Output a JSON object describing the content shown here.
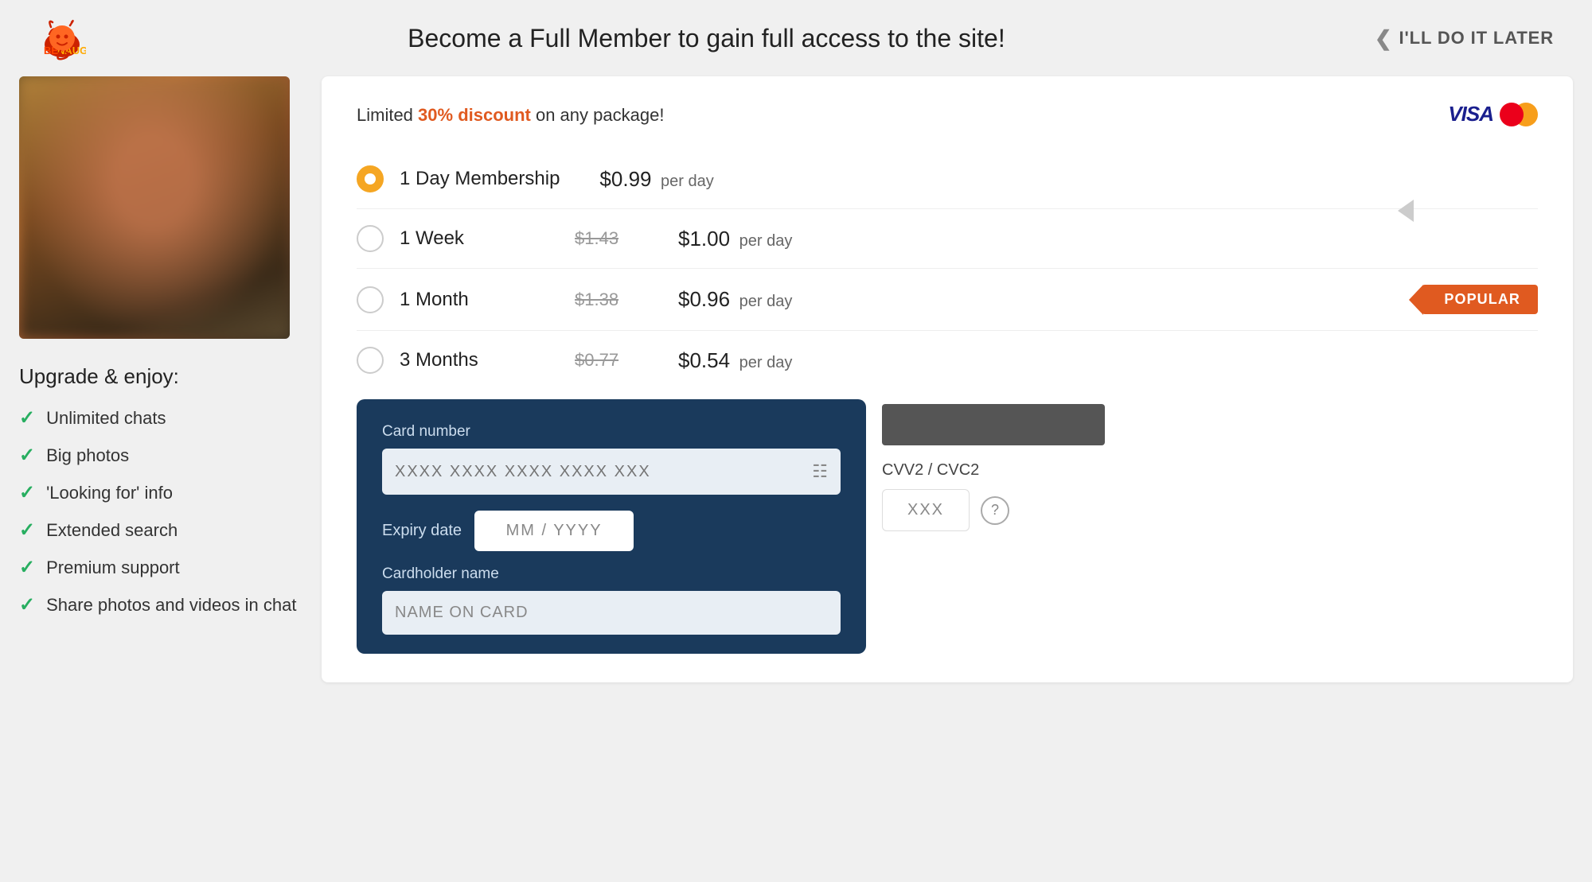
{
  "header": {
    "title": "Become a Full Member to gain full access to the site!",
    "later_button": "I'LL DO IT LATER"
  },
  "logo": {
    "text": "BENAUGHTY"
  },
  "discount": {
    "prefix": "Limited ",
    "highlight": "30% discount",
    "suffix": " on any package!"
  },
  "plans": [
    {
      "id": "1day",
      "name": "1 Day Membership",
      "old_price": null,
      "new_price": "$0.99",
      "per_day": "per day",
      "selected": true,
      "popular": false
    },
    {
      "id": "1week",
      "name": "1 Week",
      "old_price": "$1.43",
      "new_price": "$1.00",
      "per_day": "per day",
      "selected": false,
      "popular": false
    },
    {
      "id": "1month",
      "name": "1 Month",
      "old_price": "$1.38",
      "new_price": "$0.96",
      "per_day": "per day",
      "selected": false,
      "popular": true,
      "popular_label": "POPULAR"
    },
    {
      "id": "3months",
      "name": "3 Months",
      "old_price": "$0.77",
      "new_price": "$0.54",
      "per_day": "per day",
      "selected": false,
      "popular": false
    }
  ],
  "payment_form": {
    "card_number_label": "Card number",
    "card_number_placeholder": "XXXX XXXX XXXX XXXX XXX",
    "expiry_label": "Expiry date",
    "expiry_placeholder": "MM / YYYY",
    "cardholder_label": "Cardholder name",
    "cardholder_placeholder": "NAME ON CARD",
    "cvv_label": "CVV2 / CVC2",
    "cvv_placeholder": "XXX"
  },
  "upgrade": {
    "title": "Upgrade & enjoy:",
    "benefits": [
      "Unlimited chats",
      "Big photos",
      "'Looking for' info",
      "Extended search",
      "Premium support",
      "Share photos and videos in chat"
    ]
  }
}
